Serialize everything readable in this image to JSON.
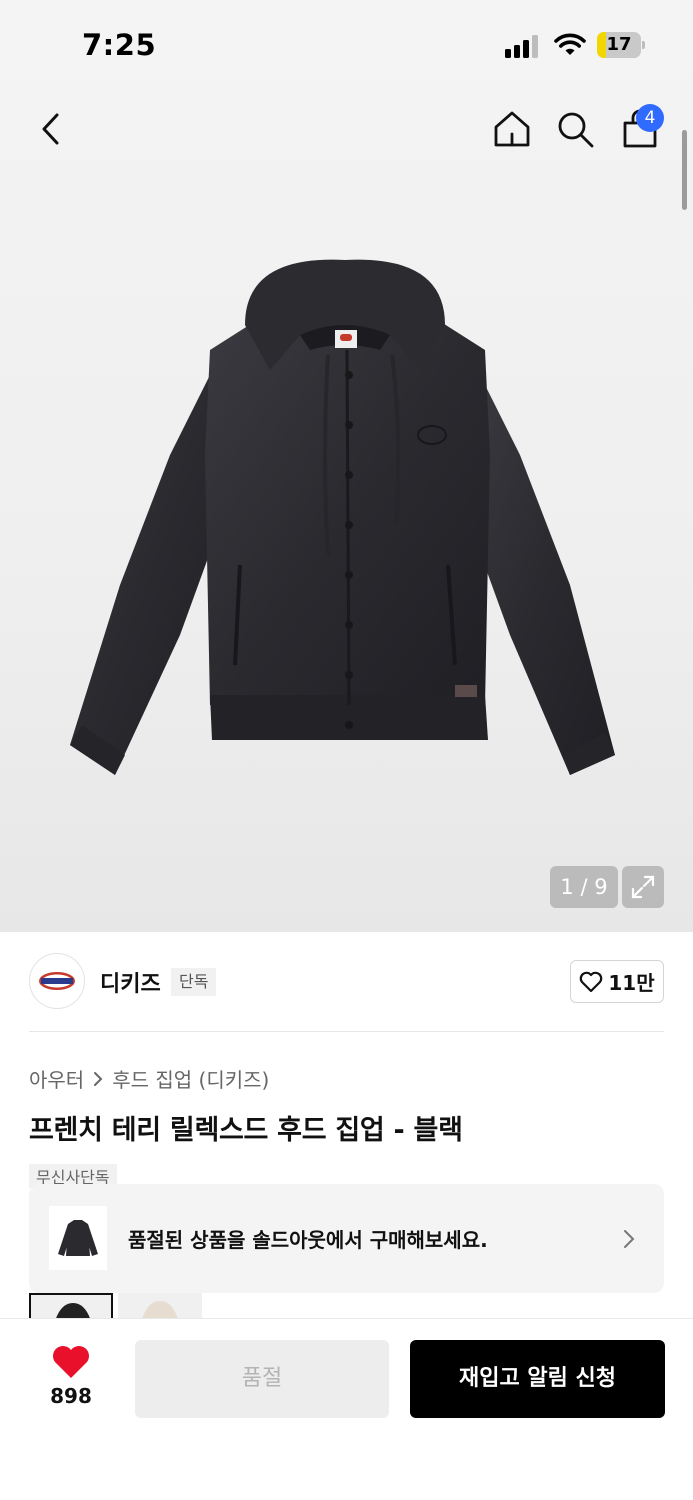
{
  "status_bar": {
    "time": "7:25",
    "battery": "17"
  },
  "nav": {
    "back_icon": "chevron-left-icon",
    "home_icon": "home-icon",
    "search_icon": "search-icon",
    "cart_icon": "cart-icon",
    "cart_count": "4"
  },
  "gallery": {
    "counter": "1 / 9",
    "expand_icon": "expand-icon"
  },
  "brand": {
    "name": "디키즈",
    "tag": "단독",
    "likes": "11만"
  },
  "product": {
    "breadcrumb": [
      "아우터",
      "후드 집업 (디키즈)"
    ],
    "title": "프렌치 테리 릴렉스드 후드 집업 - 블랙",
    "musinsa_tag": "무신사단독"
  },
  "soldout_banner": {
    "text": "품절된 상품을 솔드아웃에서 구매해보세요."
  },
  "bottom_bar": {
    "like_count": "898",
    "soldout_label": "품절",
    "restock_label": "재입고 알림 신청"
  },
  "colors": {
    "accent_blue": "#2f6bff",
    "heart_red": "#e8102b",
    "primary_black": "#000000"
  }
}
